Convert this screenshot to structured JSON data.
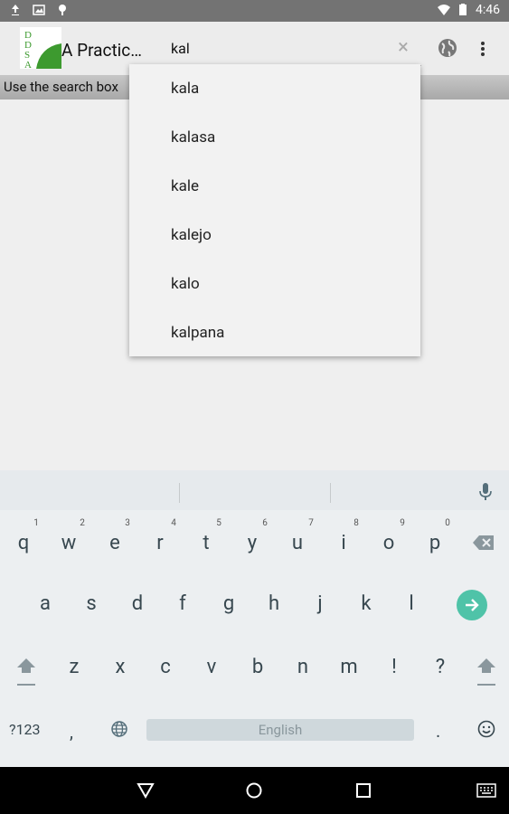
{
  "status_bar": {
    "time": "4:46"
  },
  "app_bar": {
    "title": "A Practic…",
    "logo_letters": [
      "D",
      "D",
      "S",
      "A"
    ]
  },
  "search": {
    "value": "kal"
  },
  "hint_strip": {
    "text": "Use the search box"
  },
  "suggestions": [
    "kala",
    "kalasa",
    "kale",
    "kalejo",
    "kalo",
    "kalpana"
  ],
  "keyboard": {
    "row1": [
      "q",
      "w",
      "e",
      "r",
      "t",
      "y",
      "u",
      "i",
      "o",
      "p"
    ],
    "row1_hints": [
      "1",
      "2",
      "3",
      "4",
      "5",
      "6",
      "7",
      "8",
      "9",
      "0"
    ],
    "row2": [
      "a",
      "s",
      "d",
      "f",
      "g",
      "h",
      "j",
      "k",
      "l"
    ],
    "row3": [
      "z",
      "x",
      "c",
      "v",
      "b",
      "n",
      "m",
      "!",
      "?"
    ],
    "symbols_label": "?123",
    "comma": ",",
    "period": ".",
    "space_label": "English"
  },
  "colors": {
    "accent": "#4fc3a8",
    "status_bar": "#737373",
    "logo_green": "#3d9a2f"
  }
}
